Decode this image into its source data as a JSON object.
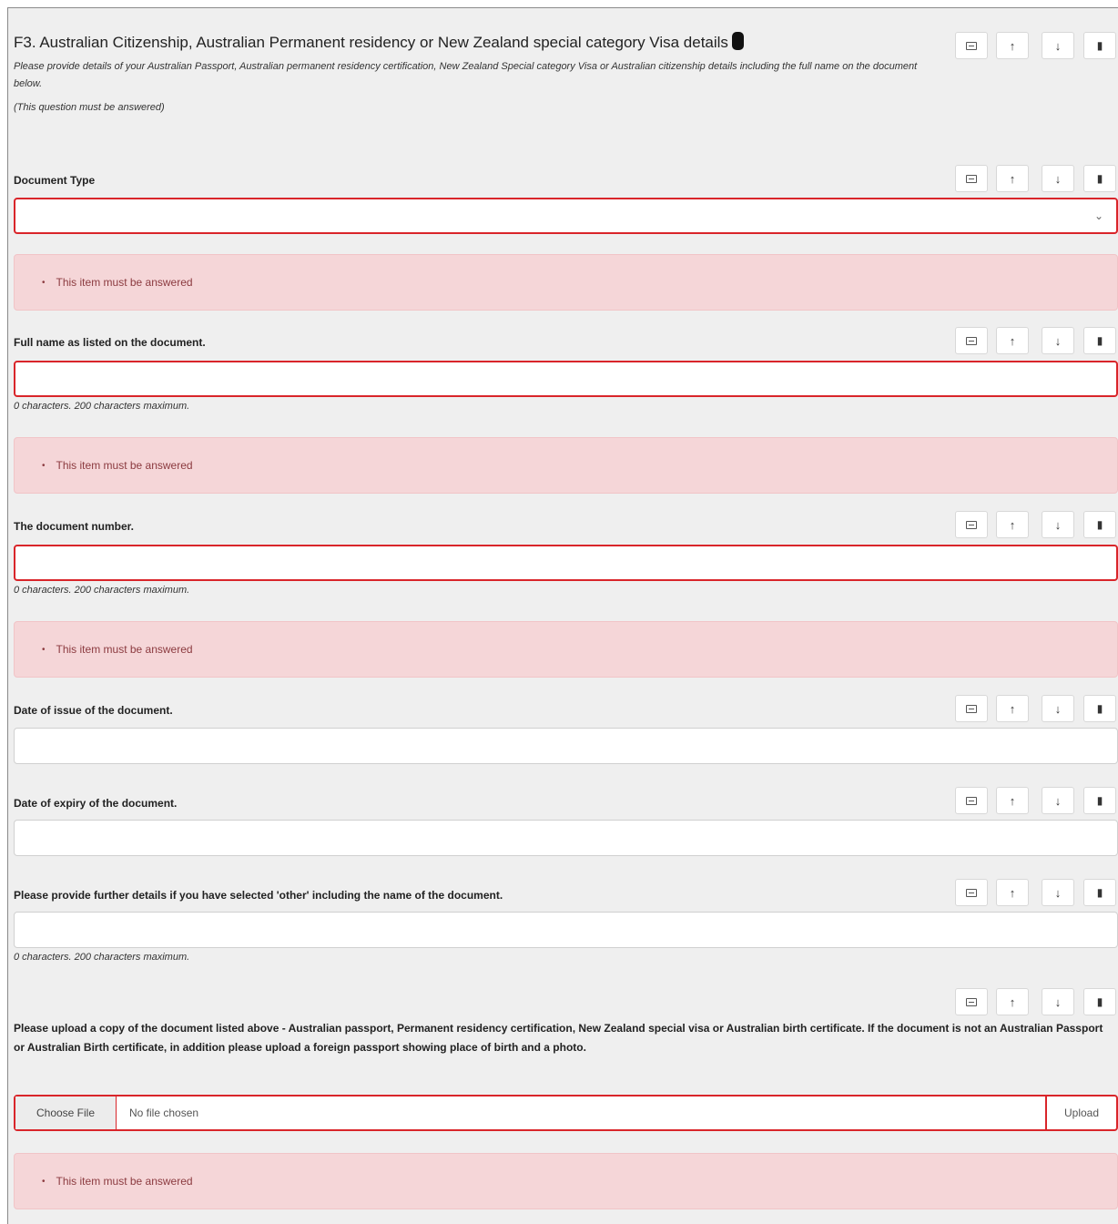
{
  "section": {
    "title": "F3. Australian Citizenship, Australian Permanent residency or New Zealand special category Visa details",
    "description": "Please provide details of your Australian Passport, Australian permanent residency certification, New Zealand Special category Visa or Australian citizenship details including the full name on the document below.",
    "required_note": "(This question must be answered)"
  },
  "toolbar": {
    "icons": [
      "grid-icon",
      "arrow-up-icon",
      "arrow-down-icon",
      "trash-icon"
    ],
    "up_glyph": "↑",
    "down_glyph": "↓"
  },
  "validation": {
    "message": "This item must be answered",
    "bullet": "•"
  },
  "questions": {
    "document_type": {
      "label": "Document Type",
      "value": "",
      "chevron": "⌄"
    },
    "full_name": {
      "label": "Full name as listed on the document.",
      "value": "",
      "counter": "0 characters. 200 characters maximum."
    },
    "document_number": {
      "label": "The document number.",
      "value": "",
      "counter": "0 characters. 200 characters maximum."
    },
    "date_issue": {
      "label": "Date of issue of the document.",
      "value": ""
    },
    "date_expiry": {
      "label": "Date of expiry of the document.",
      "value": ""
    },
    "further_details": {
      "label": "Please provide further details if you have selected 'other' including the name of the document.",
      "value": "",
      "counter": "0 characters. 200 characters maximum."
    },
    "upload": {
      "label": "Please upload a copy of the document listed above - Australian passport, Permanent residency certification, New Zealand special visa or Australian birth certificate. If the document is not an Australian Passport or Australian Birth certificate, in addition please upload a foreign passport showing place of birth and a photo.",
      "choose_label": "Choose File",
      "file_status": "No file chosen",
      "upload_label": "Upload"
    }
  },
  "colors": {
    "error_border": "#d9252a",
    "alert_bg": "#f5d6d8",
    "alert_text": "#8b3a3f",
    "panel_bg": "#efefef"
  }
}
